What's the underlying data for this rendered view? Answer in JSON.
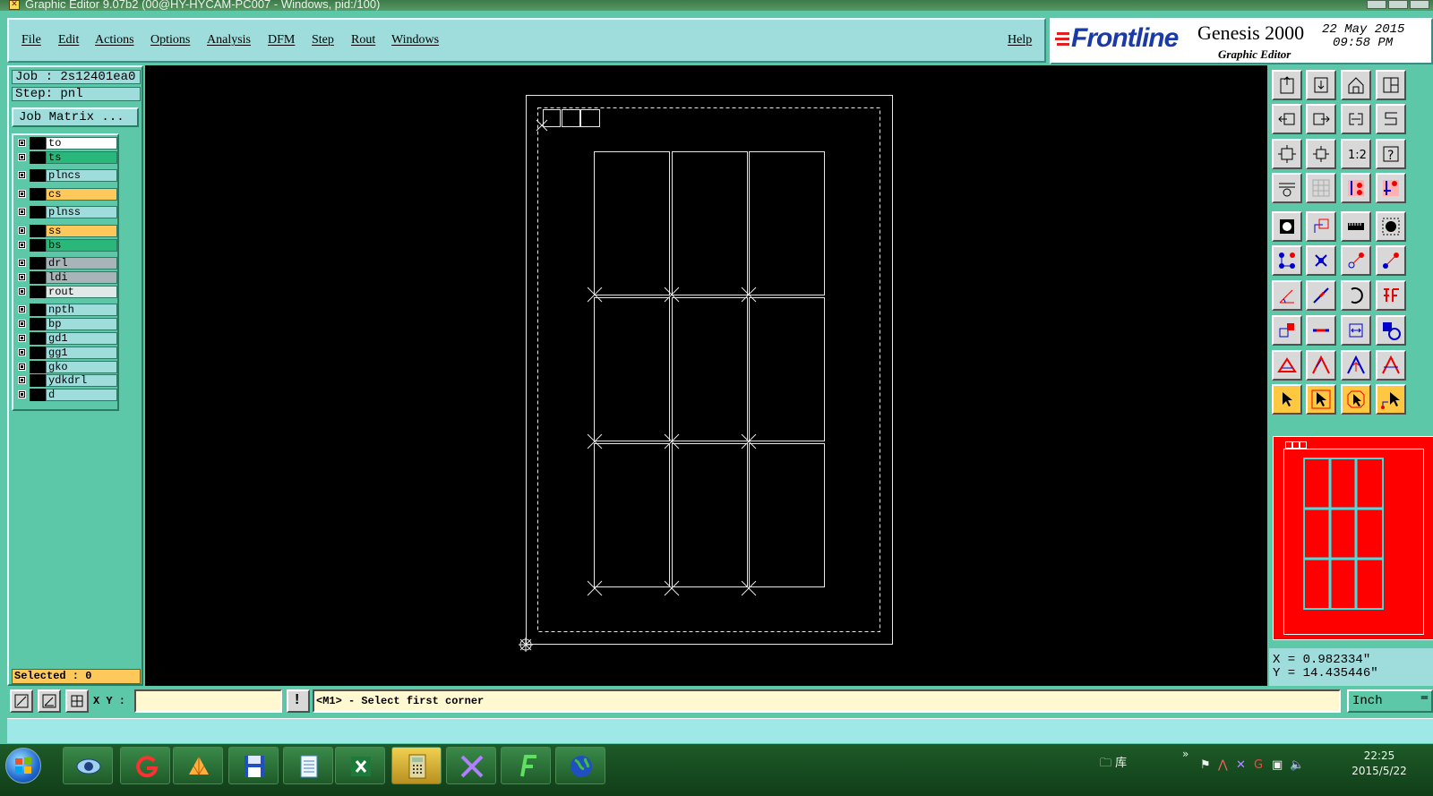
{
  "window": {
    "title": "Graphic Editor 9.07b2 (00@HY-HYCAM-PC007 - Windows, pid:/100)"
  },
  "menu": {
    "items": [
      "File",
      "Edit",
      "Actions",
      "Options",
      "Analysis",
      "DFM",
      "Step",
      "Rout",
      "Windows"
    ],
    "help": "Help"
  },
  "brand": {
    "logo": "Frontline",
    "product": "Genesis 2000",
    "subtitle": "Graphic Editor",
    "date": "22 May 2015",
    "time": "09:58 PM",
    "colors": {
      "logo_text": "#1a3aa8",
      "logo_bars": "#e02020"
    }
  },
  "job": {
    "job_label": "Job : 2s12401ea0",
    "step_label": "Step: pnl",
    "matrix_button": "Job Matrix ..."
  },
  "layers": [
    {
      "name": "to",
      "color": "#ffffff"
    },
    {
      "name": "ts",
      "color": "#2ab87a"
    },
    {
      "name": "plncs",
      "color": "#9fdcdc"
    },
    {
      "name": "cs",
      "color": "#ffc85a"
    },
    {
      "name": "plnss",
      "color": "#9fdcdc"
    },
    {
      "name": "ss",
      "color": "#ffc85a"
    },
    {
      "name": "bs",
      "color": "#2ab87a"
    },
    {
      "name": "drl",
      "color": "#a8b4b8"
    },
    {
      "name": "ldi",
      "color": "#a8b4b8"
    },
    {
      "name": "rout",
      "color": "#e0e8e8"
    },
    {
      "name": "npth",
      "color": "#9fdcdc"
    },
    {
      "name": "bp",
      "color": "#9fdcdc"
    },
    {
      "name": "gd1",
      "color": "#9fdcdc"
    },
    {
      "name": "gg1",
      "color": "#9fdcdc"
    },
    {
      "name": "gko",
      "color": "#9fdcdc"
    },
    {
      "name": "ydkdrl",
      "color": "#9fdcdc"
    },
    {
      "name": "d",
      "color": "#9fdcdc"
    }
  ],
  "selection": {
    "label": "Selected : 0"
  },
  "coords": {
    "x": "X = 0.982334\"",
    "y": "Y = 14.435446\""
  },
  "command": {
    "xy_label": "X Y :",
    "xy_value": "",
    "alert_glyph": "!",
    "prompt": "<M1> - Select first corner",
    "unit": "Inch"
  },
  "taskbar": {
    "apps": [
      "eye-app-icon",
      "g-app-icon",
      "shell-app-icon",
      "floppy-save-icon",
      "notepad-icon",
      "excel-icon",
      "calculator-icon",
      "x-app-icon",
      "f-app-icon",
      "globe-app-icon"
    ],
    "library": "库",
    "chevron": "»",
    "clock_time": "22:25",
    "clock_date": "2015/5/22"
  }
}
